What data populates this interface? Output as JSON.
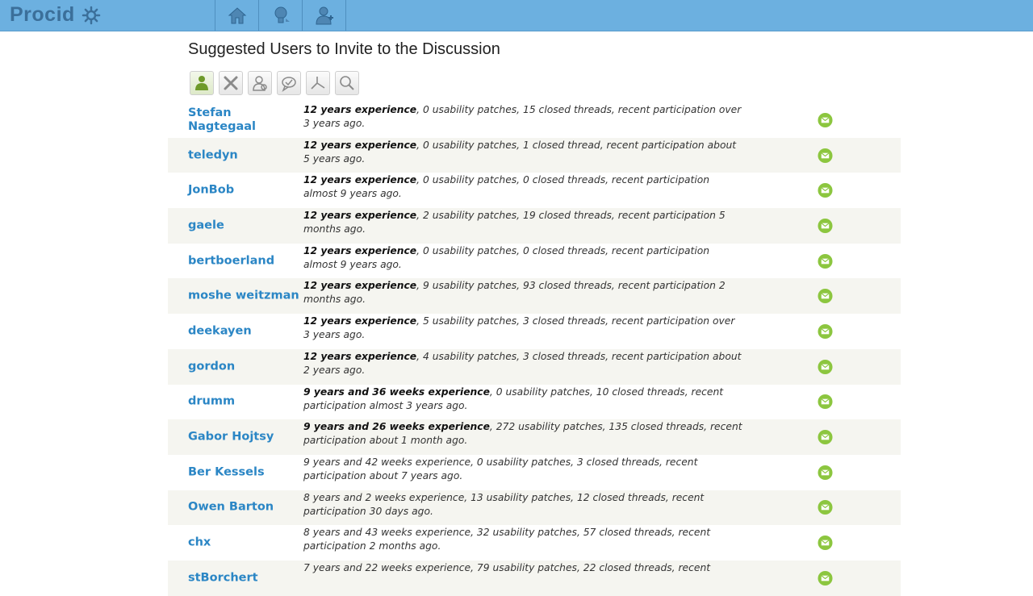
{
  "app": {
    "name": "Procid"
  },
  "page": {
    "title": "Suggested Users to Invite to the Discussion"
  },
  "nav": [
    {
      "name": "home-icon"
    },
    {
      "name": "lightbulb-icon"
    },
    {
      "name": "user-add-icon"
    }
  ],
  "tools": [
    {
      "name": "user-filter-icon",
      "active": true
    },
    {
      "name": "tools-filter-icon"
    },
    {
      "name": "user-search-filter-icon"
    },
    {
      "name": "comments-filter-icon"
    },
    {
      "name": "branch-filter-icon"
    },
    {
      "name": "search-icon"
    }
  ],
  "users": [
    {
      "name": "Stefan Nagtegaal",
      "exp": "12 years experience",
      "bold": true,
      "rest": ", 0 usability patches, 15 closed threads, recent participation over 3 years ago."
    },
    {
      "name": "teledyn",
      "exp": "12 years experience",
      "bold": true,
      "rest": ", 0 usability patches, 1 closed thread, recent participation about 5 years ago."
    },
    {
      "name": "JonBob",
      "exp": "12 years experience",
      "bold": true,
      "rest": ", 0 usability patches, 0 closed threads, recent participation almost 9 years ago."
    },
    {
      "name": "gaele",
      "exp": "12 years experience",
      "bold": true,
      "rest": ", 2 usability patches, 19 closed threads, recent participation 5 months ago."
    },
    {
      "name": "bertboerland",
      "exp": "12 years experience",
      "bold": true,
      "rest": ", 0 usability patches, 0 closed threads, recent participation almost 9 years ago."
    },
    {
      "name": "moshe weitzman",
      "exp": "12 years experience",
      "bold": true,
      "rest": ", 9 usability patches, 93 closed threads, recent participation 2 months ago."
    },
    {
      "name": "deekayen",
      "exp": "12 years experience",
      "bold": true,
      "rest": ", 5 usability patches, 3 closed threads, recent participation over 3 years ago."
    },
    {
      "name": "gordon",
      "exp": "12 years experience",
      "bold": true,
      "rest": ", 4 usability patches, 3 closed threads, recent participation about 2 years ago."
    },
    {
      "name": "drumm",
      "exp": "9 years and 36 weeks experience",
      "bold": true,
      "rest": ", 0 usability patches, 10 closed threads, recent participation almost 3 years ago."
    },
    {
      "name": "Gabor Hojtsy",
      "exp": "9 years and 26 weeks experience",
      "bold": true,
      "rest": ", 272 usability patches, 135 closed threads, recent participation about 1 month ago."
    },
    {
      "name": "Ber Kessels",
      "exp": "9 years and 42 weeks experience",
      "bold": false,
      "rest": ", 0 usability patches, 3 closed threads, recent participation about 7 years ago."
    },
    {
      "name": "Owen Barton",
      "exp": "8 years and 2 weeks experience",
      "bold": false,
      "rest": ", 13 usability patches, 12 closed threads, recent participation 30 days ago."
    },
    {
      "name": "chx",
      "exp": "8 years and 43 weeks experience",
      "bold": false,
      "rest": ", 32 usability patches, 57 closed threads, recent participation 2 months ago."
    },
    {
      "name": "stBorchert",
      "exp": "7 years and 22 weeks experience",
      "bold": false,
      "rest": ", 79 usability patches, 22 closed threads, recent"
    }
  ],
  "colors": {
    "topbar": "#6cb0e0",
    "link": "#2b86c5",
    "mail": "#8cc63f",
    "row_alt": "#f5f5f0"
  }
}
